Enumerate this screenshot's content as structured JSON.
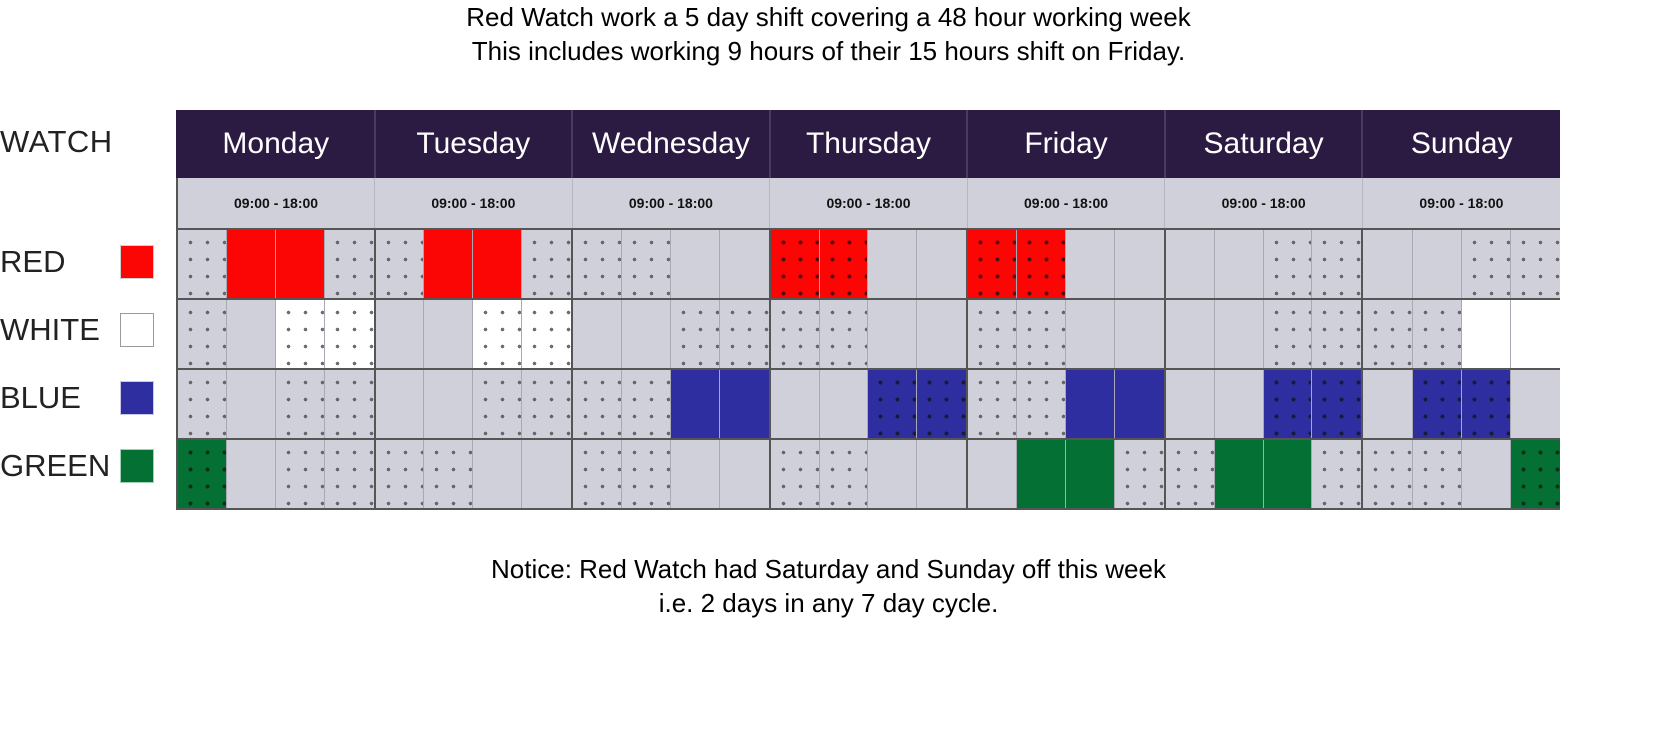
{
  "caption_top": "Red Watch work a 5 day shift covering a 48 hour working week\nThis includes working 9 hours of their 15 hours shift on Friday.",
  "caption_bottom": "Notice: Red Watch had Saturday and Sunday off this week\ni.e. 2 days in any 7 day cycle.",
  "watch_heading": "WATCH",
  "days": [
    "Monday",
    "Tuesday",
    "Wednesday",
    "Thursday",
    "Friday",
    "Saturday",
    "Sunday"
  ],
  "time_label": "09:00 - 18:00",
  "time_labels": [
    "09:00 - 18:00",
    "09:00 - 18:00",
    "09:00 - 18:00",
    "09:00 - 18:00",
    "09:00 - 18:00",
    "09:00 - 18:00",
    "09:00 - 18:00"
  ],
  "colors": {
    "header_bg": "#2b1a42",
    "grid_bg": "#d0d0da",
    "red": "#fb0505",
    "white": "#ffffff",
    "blue": "#2e2ea0",
    "green": "#057034",
    "gridline": "#555555"
  },
  "watches": [
    {
      "label": "RED",
      "swatch": "#fb0505",
      "swatch_border": "#d0d0d0"
    },
    {
      "label": "WHITE",
      "swatch": "#ffffff",
      "swatch_border": "#9a9a9a"
    },
    {
      "label": "BLUE",
      "swatch": "#2e2ea0",
      "swatch_border": "#c8c8e8"
    },
    {
      "label": "GREEN",
      "swatch": "#057034",
      "swatch_border": "#9fd2b4"
    }
  ],
  "chart_data": {
    "type": "table",
    "title": "Red Watch work a 5 day shift covering a 48 hour working week",
    "subtitle": "This includes working 9 hours of their 15 hours shift on Friday.",
    "note": "Notice: Red Watch had Saturday and Sunday off this week i.e. 2 days in any 7 day cycle.",
    "xlabel": "",
    "ylabel": "WATCH",
    "grid": true,
    "legend_position": "left",
    "categories": [
      "Monday",
      "Tuesday",
      "Wednesday",
      "Thursday",
      "Friday",
      "Saturday",
      "Sunday"
    ],
    "subcells_per_day": 4,
    "day_time_range": "09:00 - 18:00",
    "legend": [
      {
        "name": "RED",
        "color": "#fb0505"
      },
      {
        "name": "WHITE",
        "color": "#ffffff"
      },
      {
        "name": "BLUE",
        "color": "#2e2ea0"
      },
      {
        "name": "GREEN",
        "color": "#057034"
      }
    ],
    "cell_fill_key": {
      "n": "none/empty",
      "r": "red",
      "w": "white",
      "b": "blue",
      "g": "green"
    },
    "cell_dot_key": {
      "1": "dotted overlay present",
      "0": "plain"
    },
    "series": [
      {
        "name": "RED",
        "fills": [
          [
            "n",
            "r",
            "r",
            "n"
          ],
          [
            "n",
            "r",
            "r",
            "n"
          ],
          [
            "n",
            "n",
            "n",
            "n"
          ],
          [
            "r",
            "r",
            "n",
            "n"
          ],
          [
            "r",
            "r",
            "n",
            "n"
          ],
          [
            "n",
            "n",
            "n",
            "n"
          ],
          [
            "n",
            "n",
            "n",
            "n"
          ]
        ],
        "dots": [
          [
            1,
            0,
            0,
            1
          ],
          [
            1,
            0,
            0,
            1
          ],
          [
            1,
            1,
            0,
            0
          ],
          [
            1,
            1,
            0,
            0
          ],
          [
            1,
            1,
            0,
            0
          ],
          [
            0,
            0,
            1,
            1
          ],
          [
            0,
            0,
            1,
            1
          ]
        ]
      },
      {
        "name": "WHITE",
        "fills": [
          [
            "n",
            "n",
            "w",
            "w"
          ],
          [
            "n",
            "n",
            "w",
            "w"
          ],
          [
            "n",
            "n",
            "n",
            "n"
          ],
          [
            "n",
            "n",
            "n",
            "n"
          ],
          [
            "n",
            "n",
            "n",
            "n"
          ],
          [
            "n",
            "n",
            "n",
            "n"
          ],
          [
            "n",
            "n",
            "w",
            "w"
          ]
        ],
        "dots": [
          [
            1,
            0,
            1,
            1
          ],
          [
            0,
            0,
            1,
            1
          ],
          [
            0,
            0,
            1,
            1
          ],
          [
            1,
            1,
            0,
            0
          ],
          [
            1,
            1,
            0,
            0
          ],
          [
            0,
            0,
            1,
            1
          ],
          [
            1,
            1,
            0,
            0
          ]
        ]
      },
      {
        "name": "BLUE",
        "fills": [
          [
            "n",
            "n",
            "n",
            "n"
          ],
          [
            "n",
            "n",
            "n",
            "n"
          ],
          [
            "n",
            "n",
            "b",
            "b"
          ],
          [
            "n",
            "n",
            "b",
            "b"
          ],
          [
            "n",
            "n",
            "b",
            "b"
          ],
          [
            "n",
            "n",
            "b",
            "b"
          ],
          [
            "n",
            "b",
            "b",
            "n"
          ]
        ],
        "dots": [
          [
            1,
            0,
            1,
            1
          ],
          [
            0,
            0,
            1,
            1
          ],
          [
            1,
            1,
            0,
            0
          ],
          [
            0,
            0,
            1,
            1
          ],
          [
            1,
            1,
            0,
            0
          ],
          [
            0,
            0,
            1,
            1
          ],
          [
            0,
            1,
            1,
            0
          ]
        ]
      },
      {
        "name": "GREEN",
        "fills": [
          [
            "g",
            "n",
            "n",
            "n"
          ],
          [
            "n",
            "n",
            "n",
            "n"
          ],
          [
            "n",
            "n",
            "n",
            "n"
          ],
          [
            "n",
            "n",
            "n",
            "n"
          ],
          [
            "n",
            "g",
            "g",
            "n"
          ],
          [
            "n",
            "g",
            "g",
            "n"
          ],
          [
            "n",
            "n",
            "n",
            "g"
          ]
        ],
        "dots": [
          [
            1,
            0,
            1,
            1
          ],
          [
            1,
            1,
            0,
            0
          ],
          [
            1,
            1,
            0,
            0
          ],
          [
            1,
            1,
            0,
            0
          ],
          [
            0,
            0,
            0,
            1
          ],
          [
            1,
            0,
            0,
            1
          ],
          [
            1,
            1,
            0,
            1
          ]
        ]
      }
    ]
  }
}
